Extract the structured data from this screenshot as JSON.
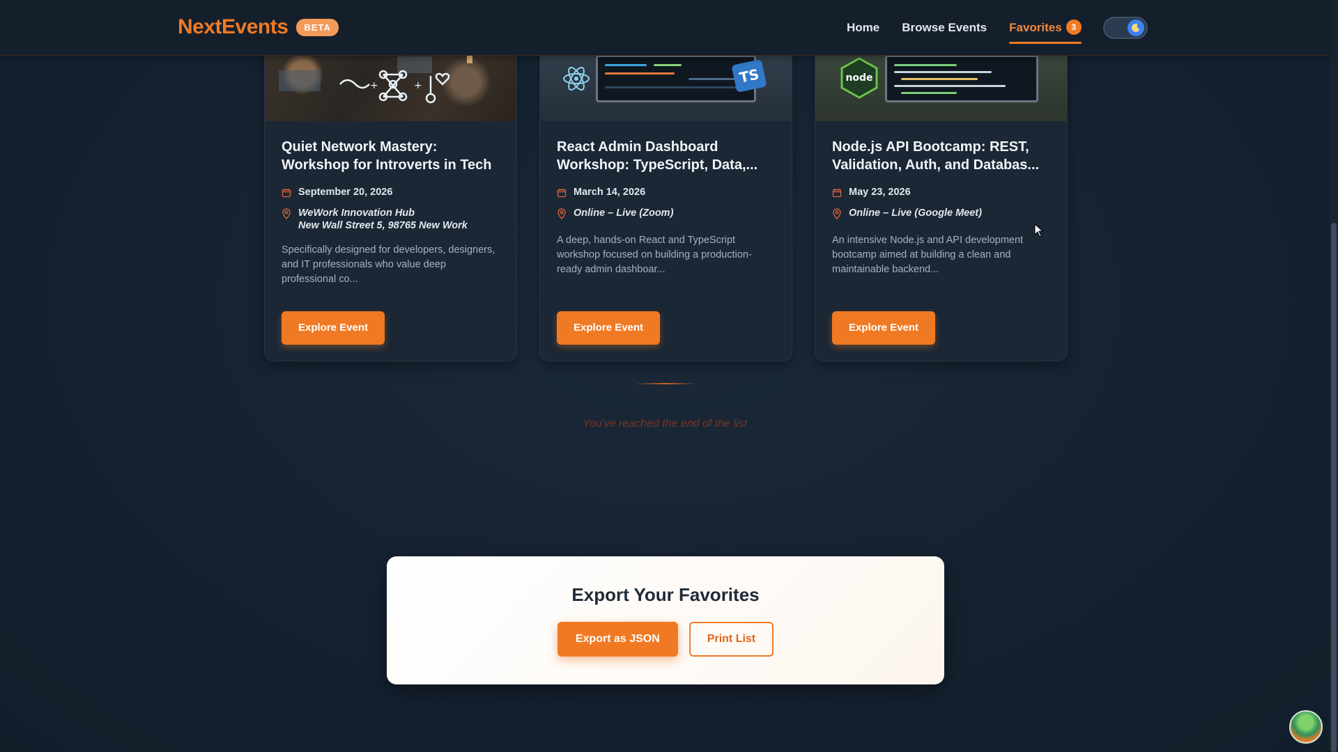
{
  "header": {
    "brand": "NextEvents",
    "badge": "BETA",
    "nav": [
      {
        "label": "Home"
      },
      {
        "label": "Browse Events"
      },
      {
        "label": "Favorites",
        "count": "3",
        "active": true
      }
    ],
    "theme_toggle_icon": "moon-icon"
  },
  "events": [
    {
      "title": "Quiet Network Mastery: Workshop for Introverts in Tech",
      "date": "September 20, 2026",
      "location_line1": "WeWork Innovation Hub",
      "location_line2": "New Wall Street 5, 98765 New Work",
      "description": "Specifically designed for developers, designers, and IT professionals who value deep professional co...",
      "button": "Explore Event"
    },
    {
      "title": "React Admin Dashboard Workshop: TypeScript, Data,...",
      "date": "March 14, 2026",
      "location_line1": "Online – Live (Zoom)",
      "location_line2": "",
      "description": "A deep, hands-on React and TypeScript workshop focused on building a production-ready admin dashboar...",
      "button": "Explore Event"
    },
    {
      "title": "Node.js API Bootcamp: REST, Validation, Auth, and Databas...",
      "date": "May 23, 2026",
      "location_line1": "Online – Live (Google Meet)",
      "location_line2": "",
      "description": "An intensive Node.js and API development bootcamp aimed at building a clean and maintainable backend...",
      "button": "Explore Event"
    }
  ],
  "end_message": "You've reached the end of the list",
  "export": {
    "title": "Export Your Favorites",
    "json_button": "Export as JSON",
    "print_button": "Print List"
  },
  "colors": {
    "accent": "#f07a24",
    "background": "#162230",
    "card": "#1b2735"
  }
}
